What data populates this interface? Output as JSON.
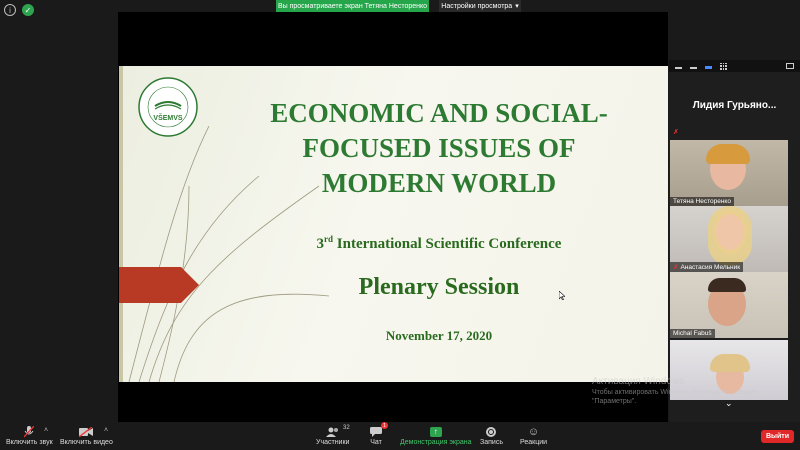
{
  "banner": {
    "sharing_text": "Вы просматриваете экран Тетяна Несторенко",
    "view_options": "Настройки просмотра"
  },
  "slide": {
    "logo_text": "VŠEMVS",
    "logo_ring_text": "VYSOKÁ ŠKOLA EKONOMIE A MANAŽMENTU VEREJNEJ SPRÁVY",
    "title_line1": "ECONOMIC AND SOCIAL-",
    "title_line2": "FOCUSED ISSUES OF",
    "title_line3": "MODERN WORLD",
    "sub_prefix": "3",
    "sub_suffix_sup": "rd",
    "sub_rest": " International Scientific Conference",
    "session": "Plenary Session",
    "date": "November 17, 2020"
  },
  "panel": {
    "speaker_name": "Лидия Гурьяно...",
    "participants": [
      {
        "name": "Тетяна Несторенко",
        "muted": false
      },
      {
        "name": "Анастасия Мельник",
        "muted": true
      },
      {
        "name": "Michal Fabuš",
        "muted": false
      },
      {
        "name": "",
        "muted": false
      }
    ]
  },
  "watermark": {
    "line1": "Активация Windows",
    "line2": "Чтобы активировать Windows, перейдите в раздел",
    "line3": "\"Параметры\"."
  },
  "toolbar": {
    "audio_label": "Включить звук",
    "video_label": "Включить видео",
    "participants_label": "Участники",
    "participants_count": "32",
    "chat_label": "Чат",
    "chat_badge": "1",
    "share_label": "Демонстрация экрана",
    "record_label": "Запись",
    "reactions_label": "Реакции",
    "exit_label": "Выйти"
  },
  "colors": {
    "slide_green": "#2d7a32",
    "share_green": "#26a64b",
    "exit_red": "#e02828",
    "arrow_red": "#b83a24"
  }
}
